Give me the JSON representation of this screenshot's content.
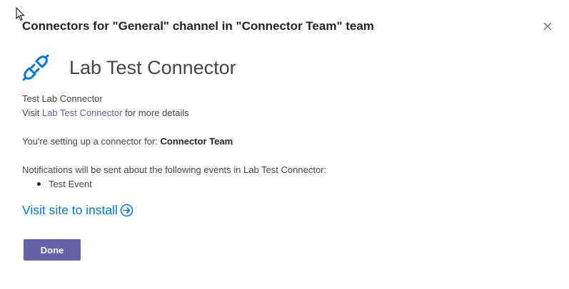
{
  "dialog": {
    "title": "Connectors for \"General\" channel in \"Connector Team\" team"
  },
  "connector": {
    "name": "Lab Test Connector",
    "icon": "plug-icon",
    "description": "Test Lab Connector",
    "visit_prefix": "Visit ",
    "visit_link": "Lab Test Connector",
    "visit_suffix": " for more details"
  },
  "setup": {
    "prefix": "You're setting up a connector for: ",
    "team": "Connector Team"
  },
  "notifications": {
    "intro": "Notifications will be sent about the following events in Lab Test Connector:",
    "events": [
      "Test Event"
    ]
  },
  "install": {
    "label": "Visit site to install",
    "icon": "arrow-circle-right-icon"
  },
  "actions": {
    "done_label": "Done"
  },
  "colors": {
    "accent": "#6264a7",
    "link_blue": "#0078d4",
    "icon_blue": "#0078d4"
  }
}
